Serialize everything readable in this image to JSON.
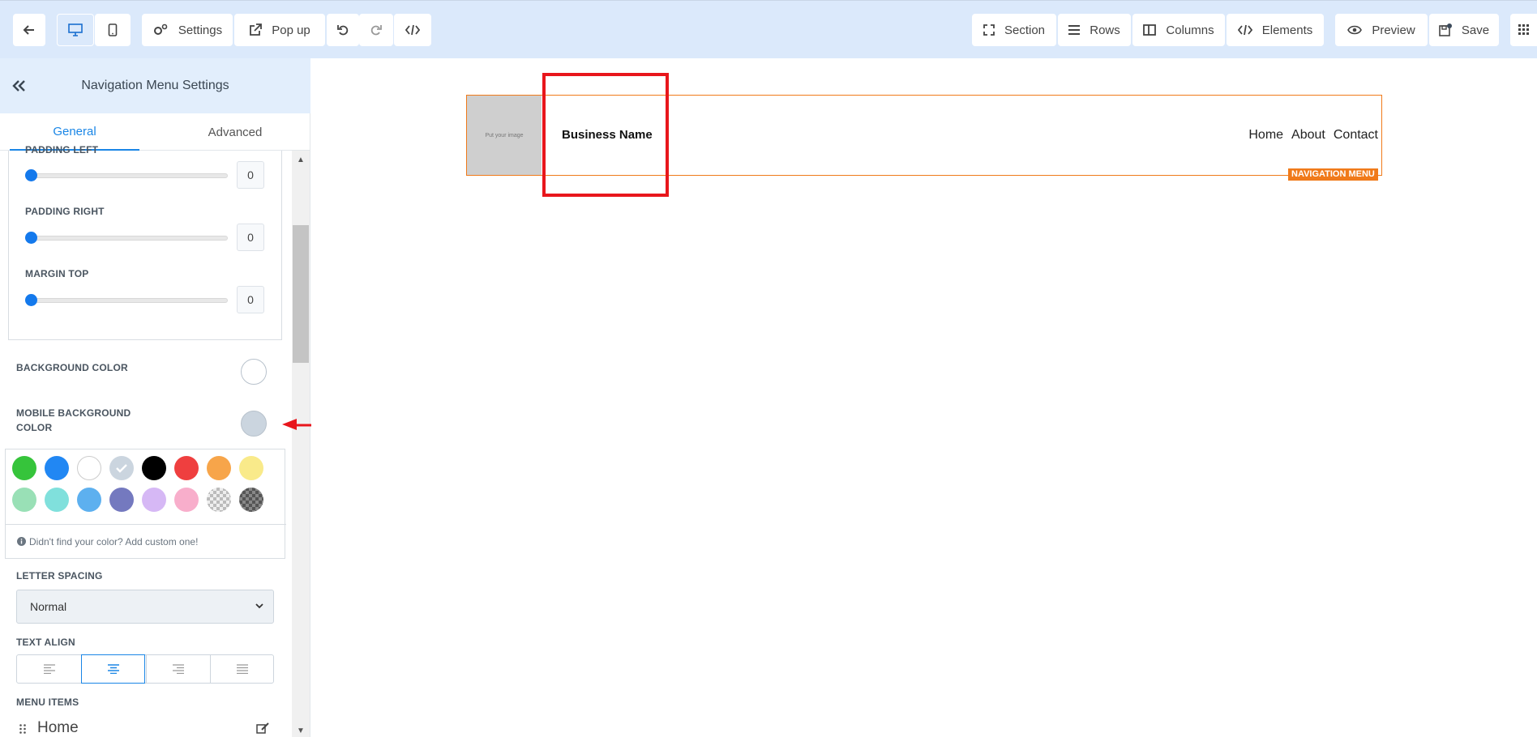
{
  "toolbar": {
    "settings_label": "Settings",
    "popup_label": "Pop up",
    "section_label": "Section",
    "rows_label": "Rows",
    "columns_label": "Columns",
    "elements_label": "Elements",
    "preview_label": "Preview",
    "save_label": "Save"
  },
  "sidebar": {
    "title": "Navigation Menu Settings",
    "tabs": [
      "General",
      "Advanced"
    ],
    "padding_left": {
      "label": "PADDING LEFT",
      "value": "0"
    },
    "padding_right": {
      "label": "PADDING RIGHT",
      "value": "0"
    },
    "margin_top": {
      "label": "MARGIN TOP",
      "value": "0"
    },
    "background_color_label": "BACKGROUND COLOR",
    "mobile_bg_label_1": "MOBILE BACKGROUND",
    "mobile_bg_label_2": "COLOR",
    "swatch_hint": "Didn't find your color? Add custom one!",
    "letter_spacing_label": "LETTER SPACING",
    "letter_spacing_value": "Normal",
    "text_align_label": "TEXT ALIGN",
    "menu_items_label": "MENU ITEMS",
    "menu_item_first": "Home"
  },
  "canvas": {
    "image_placeholder": "Put your image",
    "business_name": "Business Name",
    "nav_links": [
      "Home",
      "About",
      "Contact"
    ],
    "element_tag": "NAVIGATION MENU"
  },
  "colors": {
    "accent": "#1a86e6",
    "selection_outline": "#f07a1a",
    "annotation_red": "#e8161c",
    "mobile_bg_selected": "#cbd5df",
    "swatches_row1": [
      "#36c43b",
      "#2187f3",
      "#ffffff",
      "#cbd5df",
      "#000000",
      "#ef3f3f",
      "#f7a54a",
      "#f9ea8a"
    ],
    "swatches_row2": [
      "#99e0b6",
      "#80e0dc",
      "#5db0ef",
      "#7479bf",
      "#d6b8f5",
      "#f8aecb",
      "transparent",
      "transparent-dark"
    ]
  }
}
